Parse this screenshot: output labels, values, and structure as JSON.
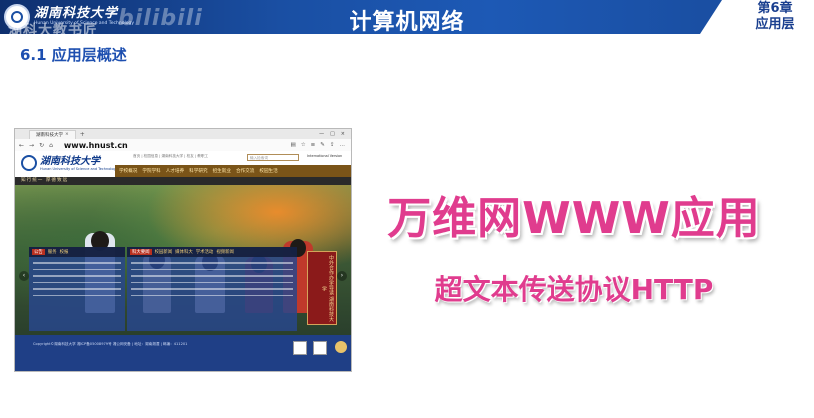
{
  "banner": {
    "school_name": "湖南科技大学",
    "school_name_en": "Hunan University of Science and Technology",
    "watermark_cn": "湖科大教书匠",
    "watermark_bili": "bilibili",
    "course_title": "计算机网络",
    "chapter_num": "第6章",
    "chapter_name": "应用层"
  },
  "section_title": "6.1 应用层概述",
  "browser": {
    "tab_label": "湖南科技大学",
    "url": "www.hnust.cn",
    "site": {
      "logo_cn": "湖南科技大学",
      "logo_en": "Hunan University of Science and Technology",
      "top_links": "首页 | 校园信息 | 湖南科技大学 | 校友 | 教职工",
      "search_placeholder": "输入检索词",
      "intl_label": "International Version",
      "nav_items": [
        "学校概况",
        "学院学科",
        "人才培养",
        "科学研究",
        "招生就业",
        "合作交流",
        "校园生活"
      ],
      "motto": "知行统一  厚德致远",
      "card1_tabs": [
        "公告",
        "服务",
        "校报"
      ],
      "card2_tabs": [
        "科大要闻",
        "校园新闻",
        "媒体科大",
        "学术活动",
        "视频新闻"
      ],
      "slogan": "中外合作办学导读 湖南科技大学",
      "footer_text": "Copyright©湖南科技大学 湘ICP备05008979号 湘公网安备 | 地址：湖南湘潭 | 邮编：411201"
    }
  },
  "slide": {
    "main_text": "万维网WWW应用",
    "sub_text": "超文本传送协议HTTP"
  },
  "colors": {
    "accent_pink": "#e03c8e",
    "banner_blue": "#1a4fa3",
    "section_blue": "#1d4fb0"
  }
}
